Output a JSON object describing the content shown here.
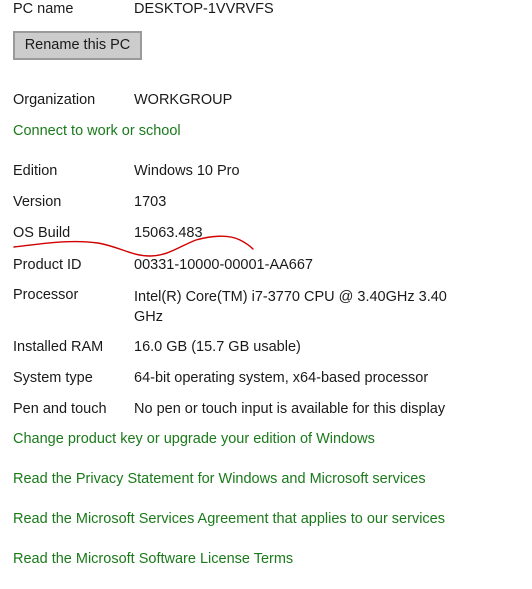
{
  "pc_name": {
    "label": "PC name",
    "value": "DESKTOP-1VVRVFS"
  },
  "rename_button": "Rename this PC",
  "organization": {
    "label": "Organization",
    "value": "WORKGROUP"
  },
  "connect_link": "Connect to work or school",
  "specs": {
    "edition": {
      "label": "Edition",
      "value": "Windows 10 Pro"
    },
    "version": {
      "label": "Version",
      "value": "1703"
    },
    "os_build": {
      "label": "OS Build",
      "value": "15063.483"
    },
    "product_id": {
      "label": "Product ID",
      "value": "00331-10000-00001-AA667"
    },
    "processor": {
      "label": "Processor",
      "value": "Intel(R) Core(TM) i7-3770 CPU @ 3.40GHz   3.40 GHz"
    },
    "installed_ram": {
      "label": "Installed RAM",
      "value": "16.0 GB (15.7 GB usable)"
    },
    "system_type": {
      "label": "System type",
      "value": "64-bit operating system, x64-based processor"
    },
    "pen_touch": {
      "label": "Pen and touch",
      "value": "No pen or touch input is available for this display"
    }
  },
  "links": {
    "change_key": "Change product key or upgrade your edition of Windows",
    "privacy": "Read the Privacy Statement for Windows and Microsoft services",
    "services_agreement": "Read the Microsoft Services Agreement that applies to our services",
    "license_terms": "Read the Microsoft Software License Terms"
  },
  "colors": {
    "link": "#1b7a1b",
    "annotation": "#d00000"
  }
}
